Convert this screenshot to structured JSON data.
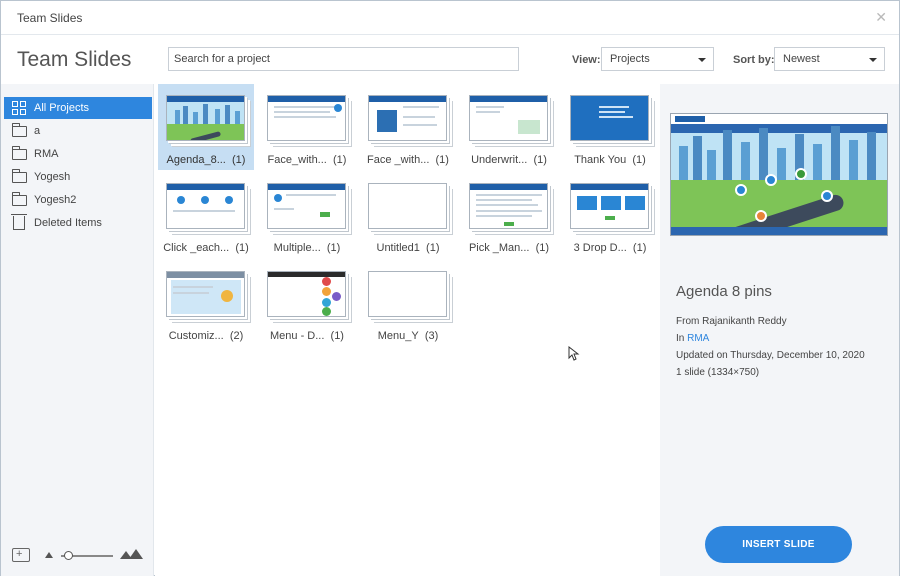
{
  "window": {
    "title": "Team Slides",
    "close_icon": "close-icon"
  },
  "header": {
    "title": "Team Slides",
    "search_placeholder": "Search for a project",
    "view_label": "View:",
    "view_value": "Projects",
    "sort_label": "Sort by:",
    "sort_value": "Newest"
  },
  "sidebar": {
    "items": [
      {
        "label": "All Projects",
        "icon": "grid-icon",
        "active": true
      },
      {
        "label": "a",
        "icon": "folder-icon"
      },
      {
        "label": "RMA",
        "icon": "folder-icon"
      },
      {
        "label": "Yogesh",
        "icon": "folder-icon"
      },
      {
        "label": "Yogesh2",
        "icon": "folder-icon"
      },
      {
        "label": "Deleted Items",
        "icon": "trash-icon"
      }
    ]
  },
  "projects": [
    {
      "name": "Agenda_8...",
      "count": "(1)",
      "selected": true
    },
    {
      "name": "Face_with...",
      "count": "(1)"
    },
    {
      "name": "Face _with...",
      "count": "(1)"
    },
    {
      "name": "Underwrit...",
      "count": "(1)"
    },
    {
      "name": "Thank You",
      "count": "(1)"
    },
    {
      "name": "Click _each...",
      "count": "(1)"
    },
    {
      "name": "Multiple...",
      "count": "(1)"
    },
    {
      "name": "Untitled1",
      "count": "(1)"
    },
    {
      "name": "Pick _Man...",
      "count": "(1)"
    },
    {
      "name": "3 Drop D...",
      "count": "(1)"
    },
    {
      "name": "Customiz...",
      "count": "(2)"
    },
    {
      "name": "Menu - D...",
      "count": "(1)"
    },
    {
      "name": "Menu_Y",
      "count": "(3)"
    }
  ],
  "details": {
    "title": "Agenda 8 pins",
    "from": "From Rajanikanth Reddy",
    "in_prefix": "In ",
    "in_link": "RMA",
    "updated": "Updated on Thursday, December 10, 2020",
    "slides": "1 slide (1334×750)",
    "insert_button": "INSERT SLIDE"
  },
  "colors": {
    "accent": "#2e86de",
    "sidebar_bg": "#f3f5f8",
    "selected_tile": "#c6def3"
  }
}
